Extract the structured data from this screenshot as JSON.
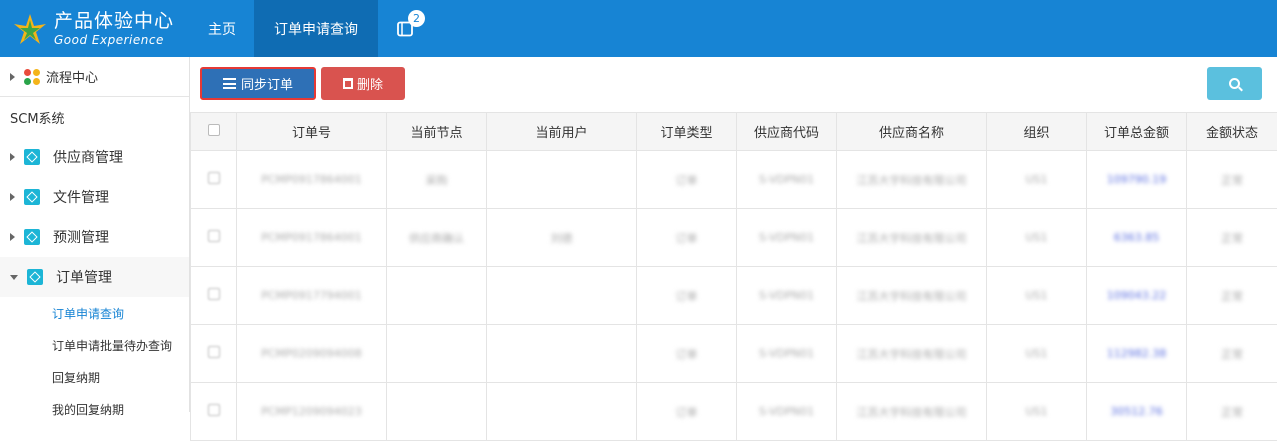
{
  "brand": {
    "name_cn": "产品体验中心",
    "name_en": "Good Experience"
  },
  "nav": {
    "home": "主页",
    "active": "订单申请查询",
    "badge_count": "2"
  },
  "sidebar": {
    "top": "流程中心",
    "section": "SCM系统",
    "items": [
      "供应商管理",
      "文件管理",
      "预测管理",
      "订单管理"
    ],
    "sub": [
      "订单申请查询",
      "订单申请批量待办查询",
      "回复纳期",
      "我的回复纳期"
    ]
  },
  "toolbar": {
    "sync_label": "同步订单",
    "delete_label": "删除"
  },
  "table": {
    "headers": [
      "订单号",
      "当前节点",
      "当前用户",
      "订单类型",
      "供应商代码",
      "供应商名称",
      "组织",
      "订单总金额",
      "金额状态"
    ],
    "rows": [
      [
        "PCMP0917864001",
        "采购",
        "",
        "订单",
        "S-VDPN01",
        "江苏大宇科技有限公司",
        "US1",
        "109790.19",
        "正常"
      ],
      [
        "PCMP0917864001",
        "供应商确认",
        "刘德",
        "订单",
        "S-VDPN01",
        "江苏大宇科技有限公司",
        "US1",
        "6363.85",
        "正常"
      ],
      [
        "PCMP0917794001",
        "",
        "",
        "订单",
        "S-VDPN01",
        "江苏大宇科技有限公司",
        "US1",
        "109043.22",
        "正常"
      ],
      [
        "PCMP0209094008",
        "",
        "",
        "订单",
        "S-VDPN01",
        "江苏大宇科技有限公司",
        "US1",
        "112982.38",
        "正常"
      ],
      [
        "PCMP1209094023",
        "",
        "",
        "订单",
        "S-VDPN01",
        "江苏大宇科技有限公司",
        "US1",
        "30512.76",
        "正常"
      ]
    ]
  },
  "colors": {
    "topbar": "#1784d4",
    "accent": "#1784d4",
    "danger": "#d9534f",
    "info": "#5bc0de",
    "primary": "#2e70b6"
  }
}
